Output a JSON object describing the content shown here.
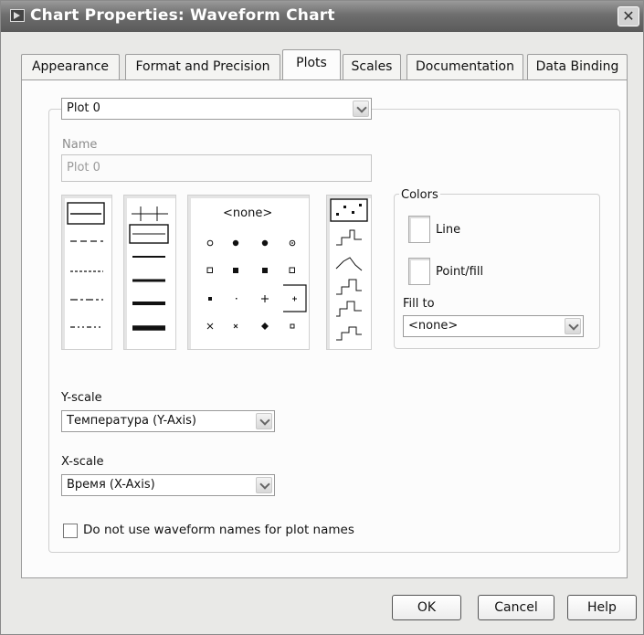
{
  "window": {
    "title": "Chart Properties: Waveform Chart"
  },
  "tabs": [
    "Appearance",
    "Format and Precision",
    "Plots",
    "Scales",
    "Documentation",
    "Data Binding"
  ],
  "active_tab": "Plots",
  "plot_selector": {
    "value": "Plot 0"
  },
  "name": {
    "label": "Name",
    "value": "Plot 0"
  },
  "point_style_picker": {
    "none_label": "<none>"
  },
  "colors": {
    "title": "Colors",
    "line_label": "Line",
    "point_fill_label": "Point/fill",
    "fill_to_label": "Fill to",
    "fill_to_value": "<none>",
    "line_color": "#ffffff",
    "point_fill_color": "#ffffff"
  },
  "y_scale": {
    "label": "Y-scale",
    "value": "Температура (Y-Axis)"
  },
  "x_scale": {
    "label": "X-scale",
    "value": "Время (X-Axis)"
  },
  "waveform_names_checkbox": {
    "label": "Do not use waveform names for plot names",
    "checked": false
  },
  "buttons": {
    "ok": "OK",
    "cancel": "Cancel",
    "help": "Help"
  },
  "icons": [
    "app-icon",
    "close-icon",
    "chevron-down-icon"
  ]
}
